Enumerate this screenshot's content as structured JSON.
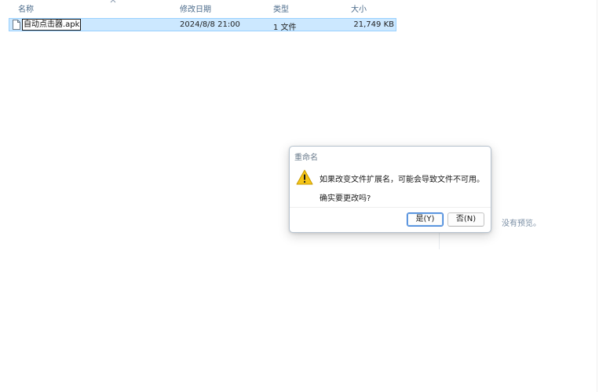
{
  "columns": {
    "name": "名称",
    "modified": "修改日期",
    "type": "类型",
    "size": "大小"
  },
  "file": {
    "name": "自动点击器.apk",
    "modified": "2024/8/8 21:00",
    "type": "1 文件",
    "size": "21,749 KB"
  },
  "preview": {
    "empty_text": "没有预览。"
  },
  "dialog": {
    "title": "重命名",
    "message": "如果改变文件扩展名，可能会导致文件不可用。",
    "question": "确实要更改吗?",
    "yes_label": "是(Y)",
    "no_label": "否(N)"
  },
  "icons": {
    "file": "file-icon",
    "warning": "warning-icon",
    "sort": "sort-up-icon"
  },
  "colors": {
    "selection_bg": "#cce8ff",
    "selection_border": "#99d1ff",
    "header_text": "#4a6a8a",
    "warning_yellow": "#f5c518",
    "primary_button_border": "#3a7bd5"
  }
}
